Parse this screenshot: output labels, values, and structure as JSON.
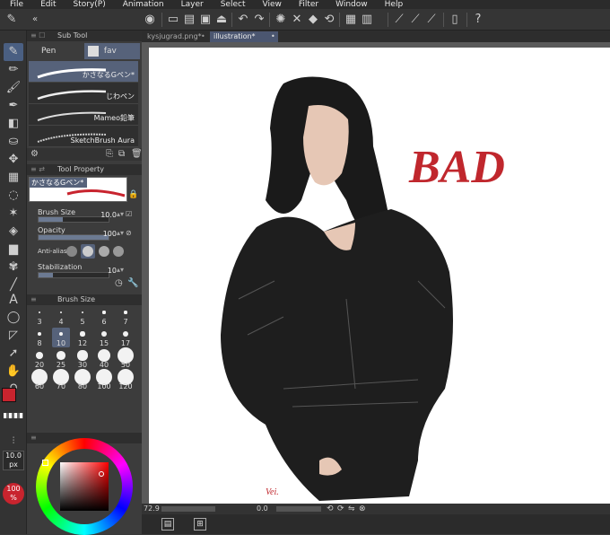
{
  "menu": [
    "File",
    "Edit",
    "Story(P)",
    "Animation",
    "Layer",
    "Select",
    "View",
    "Filter",
    "Window",
    "Help"
  ],
  "tabs": [
    {
      "label": "kysjugrad.png*"
    },
    {
      "label": "illustration*"
    }
  ],
  "subtool": {
    "title": "Sub Tool",
    "tabs": [
      "Pen",
      "fav"
    ],
    "brushes": [
      "かさなるGペン*",
      "じわペン",
      "Mameo鉛筆",
      "SketchBrush Aura"
    ]
  },
  "tool_property": {
    "title": "Tool Property",
    "preview_name": "かさなるGペン*",
    "brush_size_label": "Brush Size",
    "brush_size_value": "10.0",
    "brush_size_fill": 0.35,
    "opacity_label": "Opacity",
    "opacity_value": "100",
    "opacity_fill": 1.0,
    "antialias_label": "Anti-aliasi",
    "stabilization_label": "Stabilization",
    "stabilization_value": "10",
    "stabilization_fill": 0.2
  },
  "brush_size_panel": {
    "title": "Brush Size",
    "sizes": [
      "3",
      "4",
      "5",
      "6",
      "7",
      "8",
      "10",
      "12",
      "15",
      "17",
      "20",
      "25",
      "30",
      "40",
      "50",
      "60",
      "70",
      "80",
      "100",
      "120"
    ],
    "selected": "10"
  },
  "color_panel": {
    "size_value": "10.0",
    "size_unit": "px",
    "opacity_value": "100",
    "opacity_unit": "%",
    "main_color": "#c8242e",
    "sub_color": "#ffffff"
  },
  "status": {
    "zoom": "72.9",
    "bottom_value": "0.0"
  },
  "artwork": {
    "text": "BAD",
    "text_color": "#c0272d",
    "signature": "Vei."
  },
  "colors": {
    "active_tool": "#4a5f82",
    "selected_brush": "#56627a"
  }
}
